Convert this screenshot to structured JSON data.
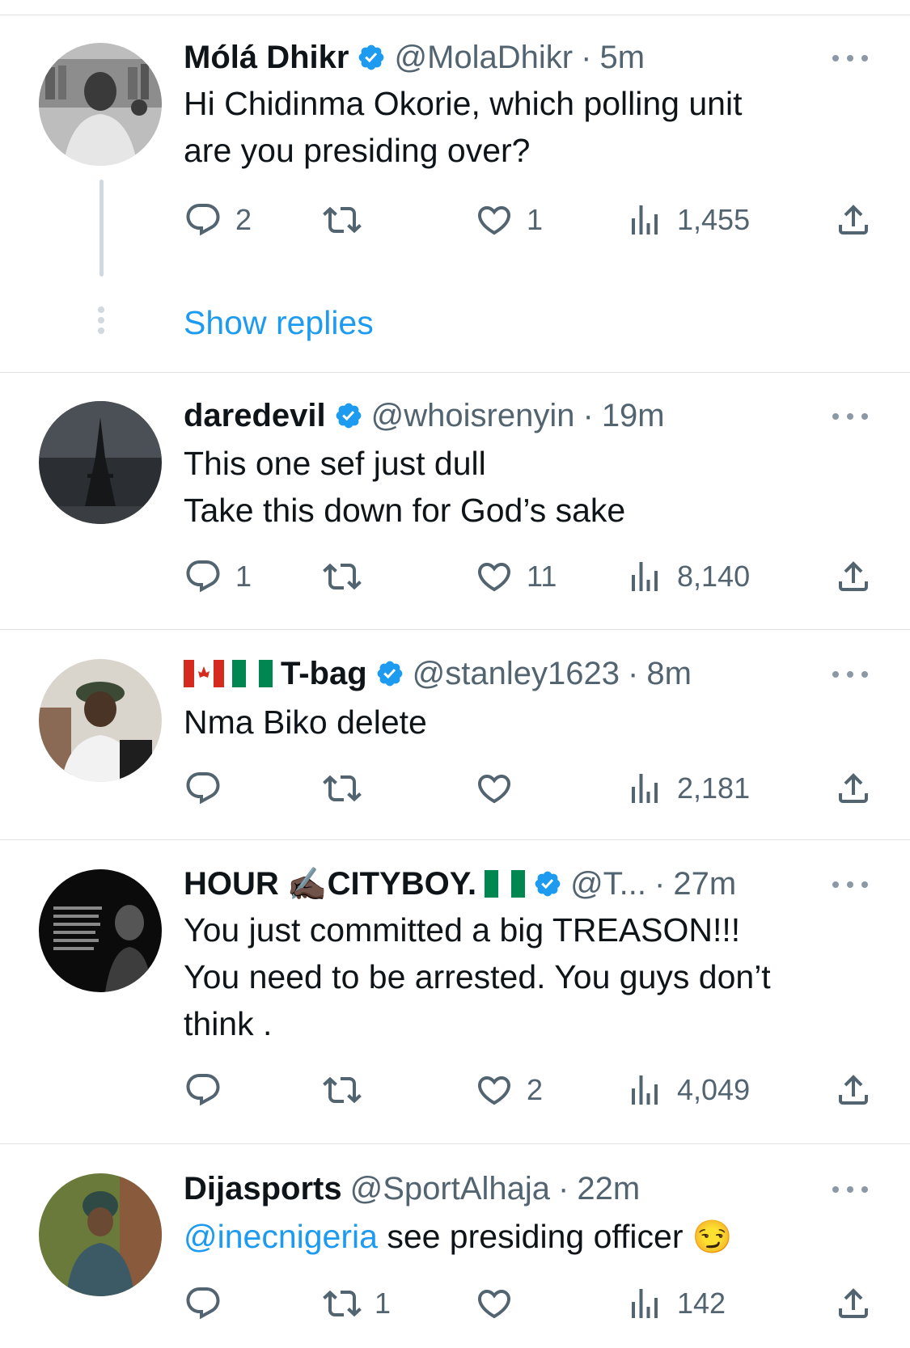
{
  "tweets": [
    {
      "name": "Mólá Dhikr",
      "handle": "@MolaDhikr",
      "time": "5m",
      "lines": [
        "Hi Chidinma Okorie, which polling unit",
        "are you presiding over?"
      ],
      "replies": "2",
      "retweets": "",
      "likes": "1",
      "views": "1,455",
      "avatar_icon": "avatar-man-bookshelf",
      "show_replies": "Show replies"
    },
    {
      "name": "daredevil",
      "handle": "@whoisrenyin",
      "time": "19m",
      "lines": [
        "This one sef just dull",
        "Take this down for God’s sake"
      ],
      "replies": "1",
      "retweets": "",
      "likes": "11",
      "views": "8,140",
      "avatar_icon": "avatar-eiffel-tower"
    },
    {
      "name": "T-bag",
      "flags": [
        "canada-flag-icon",
        "nigeria-flag-icon"
      ],
      "handle": "@stanley1623",
      "time": "8m",
      "lines": [
        "Nma Biko delete"
      ],
      "replies": "",
      "retweets": "",
      "likes": "",
      "views": "2,181",
      "avatar_icon": "avatar-man-selfie"
    },
    {
      "name_part1": "HOUR",
      "name_emoji": "✍🏿",
      "name_part2": "CITYBOY.",
      "handle": "@T...",
      "time": "27m",
      "lines": [
        "You just committed a big TREASON!!!",
        "You need to be arrested. You guys don’t",
        "think ."
      ],
      "replies": "",
      "retweets": "",
      "likes": "2",
      "views": "4,049",
      "avatar_icon": "avatar-quote-card"
    },
    {
      "name": "Dijasports",
      "handle": "@SportAlhaja",
      "time": "22m",
      "mention": "@inecnigeria",
      "line_rest": " see presiding officer ",
      "emoji": "😏",
      "replies": "",
      "retweets": "1",
      "likes": "",
      "views": "142",
      "avatar_icon": "avatar-woman-headwrap"
    }
  ],
  "colors": {
    "accent": "#1d9bf0",
    "muted": "#536471",
    "verified": "#1d9bf0",
    "separator": "#dfe3e6"
  }
}
